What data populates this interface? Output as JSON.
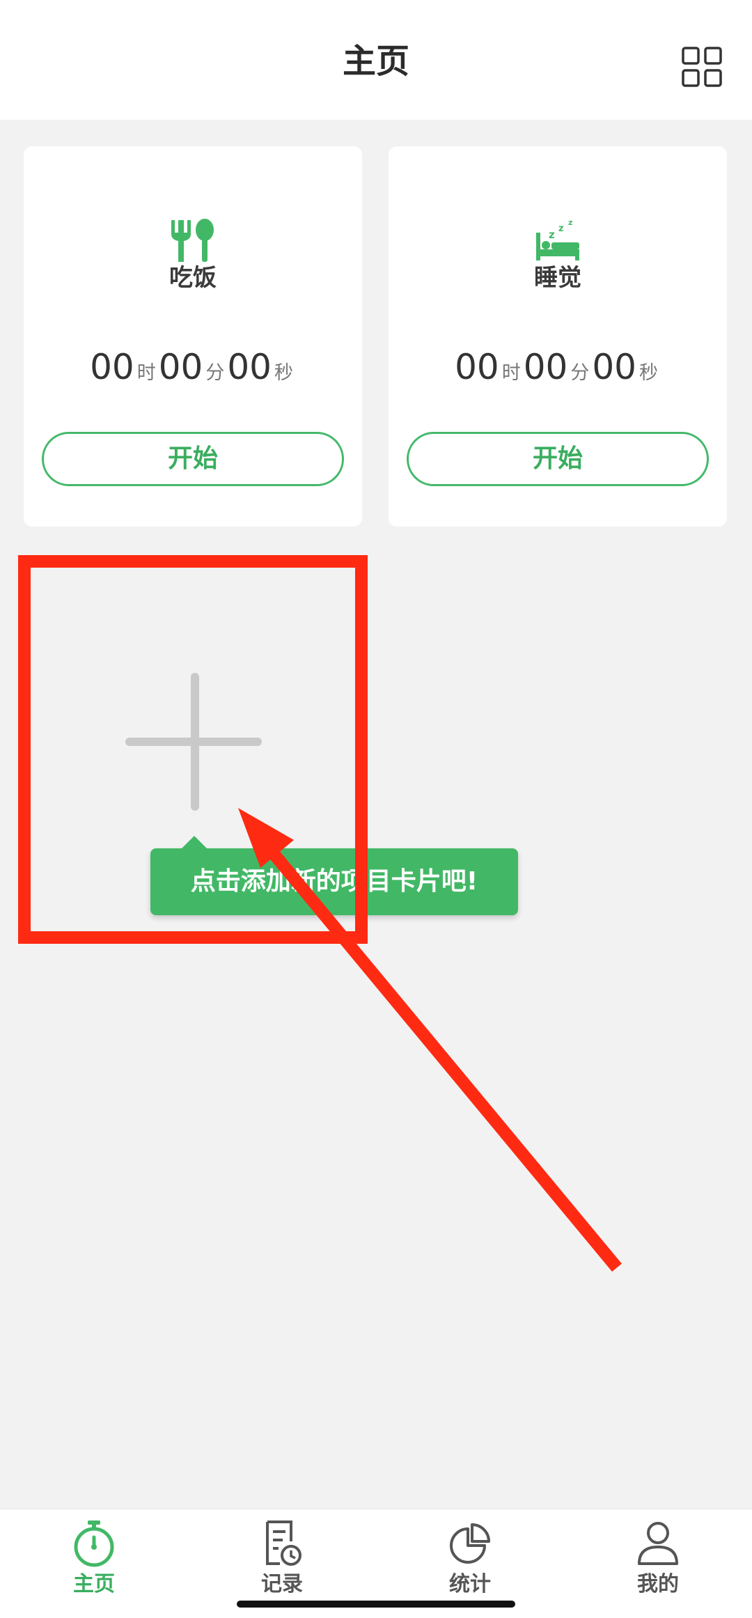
{
  "header": {
    "title": "主页",
    "right_icon": "grid-icon"
  },
  "cards": [
    {
      "icon": "fork-spoon-icon",
      "name": "吃饭",
      "hours": "00",
      "hours_unit": "时",
      "minutes": "00",
      "minutes_unit": "分",
      "seconds": "00",
      "seconds_unit": "秒",
      "start_label": "开始"
    },
    {
      "icon": "sleep-bed-icon",
      "name": "睡觉",
      "hours": "00",
      "hours_unit": "时",
      "minutes": "00",
      "minutes_unit": "分",
      "seconds": "00",
      "seconds_unit": "秒",
      "start_label": "开始"
    }
  ],
  "add_card": {
    "icon": "plus-icon",
    "tooltip": "点击添加新的项目卡片吧!"
  },
  "tabbar": {
    "items": [
      {
        "label": "主页",
        "icon": "stopwatch-icon",
        "active": true
      },
      {
        "label": "记录",
        "icon": "record-icon",
        "active": false
      },
      {
        "label": "统计",
        "icon": "pie-chart-icon",
        "active": false
      },
      {
        "label": "我的",
        "icon": "user-icon",
        "active": false
      }
    ]
  },
  "colors": {
    "accent": "#42b866",
    "annotation": "#ff2a12",
    "background": "#f2f2f2"
  }
}
